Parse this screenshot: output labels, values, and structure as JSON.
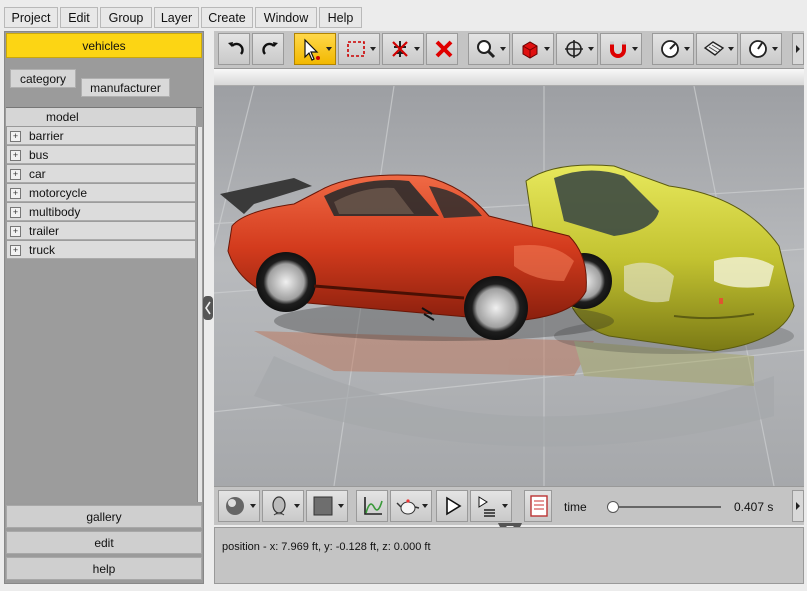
{
  "menubar": {
    "items": [
      "Project",
      "Edit",
      "Group",
      "Layer",
      "Create",
      "Window",
      "Help"
    ]
  },
  "left_panel": {
    "vehicles_tab": "vehicles",
    "subtabs": [
      "category",
      "manufacturer"
    ],
    "list": {
      "header": "model",
      "items": [
        "barrier",
        "bus",
        "car",
        "motorcycle",
        "multibody",
        "trailer",
        "truck"
      ]
    },
    "bottom_buttons": [
      "gallery",
      "edit",
      "help"
    ]
  },
  "toolbar": {
    "buttons": [
      "undo-icon",
      "redo-icon",
      "select-arrow-icon",
      "selection-rect-icon",
      "delete-constraint-icon",
      "delete-x-icon",
      "zoom-icon",
      "cube-icon",
      "move-icon",
      "magnet-icon",
      "rotate-icon",
      "surface-icon",
      "gauge-icon"
    ],
    "active": "select-arrow-icon"
  },
  "bottom_toolbar": {
    "time_label": "time",
    "time_value": "0.407 s",
    "time_fraction": 0.02
  },
  "status": {
    "position_text": "position - x: 7.969 ft, y: -0.128 ft, z: 0.000 ft"
  },
  "colors": {
    "accent": "#fcd514",
    "red_car": "#d93a1e",
    "yellow_car": "#c2c232"
  }
}
